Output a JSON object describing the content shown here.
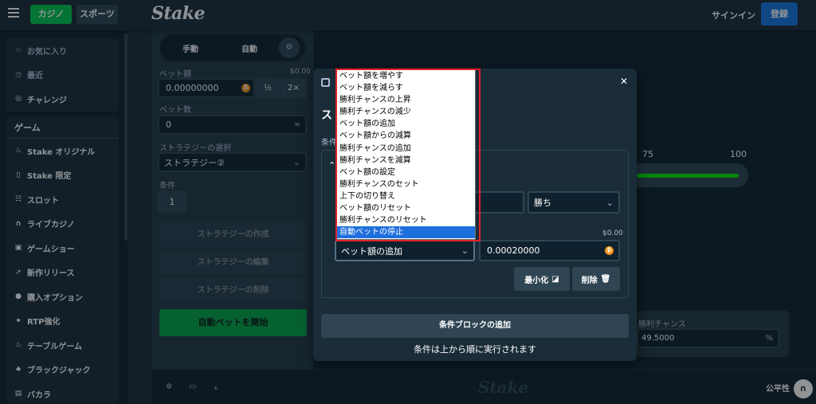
{
  "header": {
    "casino_tab": "カジノ",
    "sports_tab": "スポーツ",
    "logo": "Stake",
    "signin": "サインイン",
    "register": "登録"
  },
  "sidebar": {
    "group1": [
      {
        "label": "お気に入り",
        "icon": "star-icon"
      },
      {
        "label": "最近",
        "icon": "history-icon"
      },
      {
        "label": "チャレンジ",
        "icon": "challenge-icon"
      }
    ],
    "games_header": "ゲーム",
    "games": [
      {
        "label": "Stake オリジナル",
        "icon": "flame-icon"
      },
      {
        "label": "Stake 限定",
        "icon": "bookmark-icon"
      },
      {
        "label": "スロット",
        "icon": "slots-icon"
      },
      {
        "label": "ライブカジノ",
        "icon": "headset-icon"
      },
      {
        "label": "ゲームショー",
        "icon": "gift-icon"
      },
      {
        "label": "新作リリース",
        "icon": "rocket-icon"
      },
      {
        "label": "購入オプション",
        "icon": "coins-icon"
      },
      {
        "label": "RTP強化",
        "icon": "rtp-icon"
      },
      {
        "label": "テーブルゲーム",
        "icon": "flame-icon"
      },
      {
        "label": "ブラックジャック",
        "icon": "spade-icon"
      },
      {
        "label": "バカラ",
        "icon": "cards-icon"
      }
    ]
  },
  "left_panel": {
    "mode_manual": "手動",
    "mode_auto": "自動",
    "bet_amount_label": "ベット額",
    "bet_amount_usd": "$0.00",
    "bet_amount_value": "0.00000000",
    "half_btn": "½",
    "double_btn": "2×",
    "bet_count_label": "ベット数",
    "bet_count_value": "0",
    "strategy_label": "ストラテジーの選択",
    "strategy_value": "ストラテジー②",
    "conditions_label": "条件",
    "conditions_value": "1",
    "create_btn": "ストラテジーの作成",
    "edit_btn": "ストラテジーの編集",
    "delete_btn": "ストラテジーの削除",
    "start_btn": "自動ベットを開始"
  },
  "game": {
    "scale_75": "75",
    "scale_100": "100",
    "win_chance_label": "勝利チャンス",
    "win_chance_value": "49.5000",
    "percent": "%",
    "footer_logo": "Stake",
    "fairness": "公平性"
  },
  "modal": {
    "title": "スト",
    "subtitle": "条件",
    "result_select": "勝ち",
    "usd_value": "$0.00",
    "action_select": "ベット額の追加",
    "amount_value": "0.00020000",
    "minimize_btn": "最小化",
    "delete_btn": "削除",
    "add_block_btn": "条件ブロックの追加",
    "note": "条件は上から順に実行されます"
  },
  "dropdown": {
    "options": [
      "ベット額を増やす",
      "ベット額を減らす",
      "勝利チャンスの上昇",
      "勝利チャンスの減少",
      "ベット額の追加",
      "ベット額からの減算",
      "勝利チャンスの追加",
      "勝利チャンスを減算",
      "ベット額の設定",
      "勝利チャンスのセット",
      "上下の切り替え",
      "ベット額のリセット",
      "勝利チャンスのリセット",
      "自動ベットの停止"
    ],
    "selected_index": 13
  },
  "colors": {
    "bg": "#1a2c38",
    "panel": "#213743",
    "dark": "#0f212e",
    "green": "#00c74d",
    "blue": "#1475e1",
    "highlight": "#e0242b"
  }
}
